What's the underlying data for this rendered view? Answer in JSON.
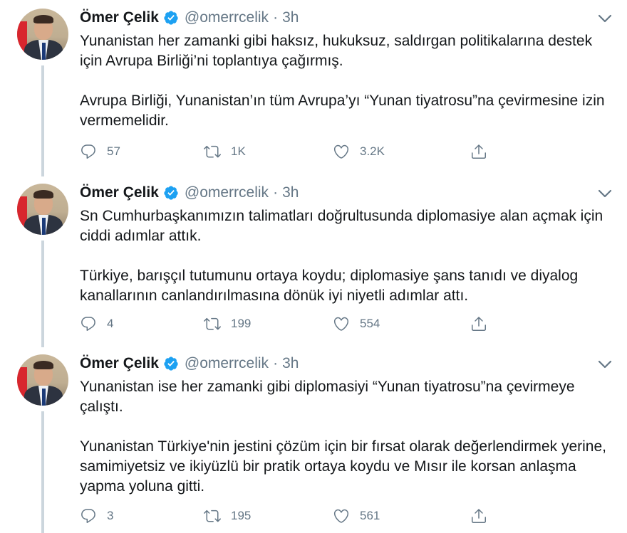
{
  "tweets": [
    {
      "author": {
        "name": "Ömer Çelik",
        "handle": "@omerrcelik",
        "verified": true
      },
      "time": "3h",
      "paragraphs": [
        "Yunanistan her zamanki gibi haksız, hukuksuz, saldırgan politikalarına destek için Avrupa Birliği’ni toplantıya çağırmış.",
        "Avrupa Birliği, Yunanistan’ın tüm Avrupa’yı “Yunan tiyatrosu”na çevirmesine izin vermemelidir."
      ],
      "stats": {
        "replies": "57",
        "retweets": "1K",
        "likes": "3.2K"
      }
    },
    {
      "author": {
        "name": "Ömer Çelik",
        "handle": "@omerrcelik",
        "verified": true
      },
      "time": "3h",
      "paragraphs": [
        "Sn Cumhurbaşkanımızın talimatları doğrultusunda diplomasiye alan açmak için ciddi adımlar attık.",
        "Türkiye, barışçıl tutumunu ortaya koydu; diplomasiye şans tanıdı ve diyalog kanallarının canlandırılmasına dönük iyi niyetli adımlar attı."
      ],
      "stats": {
        "replies": "4",
        "retweets": "199",
        "likes": "554"
      }
    },
    {
      "author": {
        "name": "Ömer Çelik",
        "handle": "@omerrcelik",
        "verified": true
      },
      "time": "3h",
      "paragraphs": [
        "Yunanistan ise her zamanki gibi diplomasiyi “Yunan tiyatrosu”na çevirmeye çalıştı.",
        "Yunanistan Türkiye'nin jestini çözüm için bir fırsat olarak değerlendirmek yerine, samimiyetsiz ve ikiyüzlü bir pratik ortaya koydu ve Mısır ile korsan anlaşma yapma yoluna gitti."
      ],
      "stats": {
        "replies": "3",
        "retweets": "195",
        "likes": "561"
      }
    }
  ],
  "icons": {
    "verified": "verified-badge-icon",
    "caret": "chevron-down-icon",
    "reply": "reply-icon",
    "retweet": "retweet-icon",
    "like": "heart-icon",
    "share": "share-icon"
  },
  "colors": {
    "verified_blue": "#1da1f2",
    "secondary_text": "#657786",
    "primary_text": "#14171a",
    "thread_line": "#ccd6dd"
  }
}
